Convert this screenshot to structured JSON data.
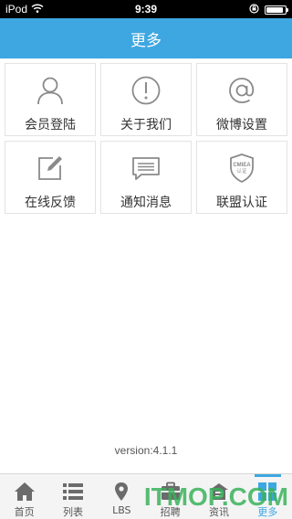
{
  "status": {
    "carrier": "iPod",
    "time": "9:39",
    "battery_level": 0.9
  },
  "header": {
    "title": "更多"
  },
  "grid": [
    {
      "label": "会员登陆",
      "icon": "user-icon"
    },
    {
      "label": "关于我们",
      "icon": "info-alert-icon"
    },
    {
      "label": "微博设置",
      "icon": "at-icon"
    },
    {
      "label": "在线反馈",
      "icon": "edit-icon"
    },
    {
      "label": "通知消息",
      "icon": "message-icon"
    },
    {
      "label": "联盟认证",
      "icon": "certificate-shield-icon",
      "badge_text": "CMIEA 认证"
    }
  ],
  "version": "version:4.1.1",
  "tabbar": [
    {
      "label": "首页",
      "icon": "home-icon"
    },
    {
      "label": "列表",
      "icon": "list-icon"
    },
    {
      "label": "LBS",
      "icon": "location-pin-icon"
    },
    {
      "label": "招聘",
      "icon": "recruit-icon"
    },
    {
      "label": "资讯",
      "icon": "news-icon"
    },
    {
      "label": "更多",
      "icon": "more-grid-icon",
      "active": true
    }
  ],
  "watermark": "ITMOP.COM",
  "colors": {
    "accent": "#3ea7e1",
    "icon_gray": "#8a8a8a"
  }
}
